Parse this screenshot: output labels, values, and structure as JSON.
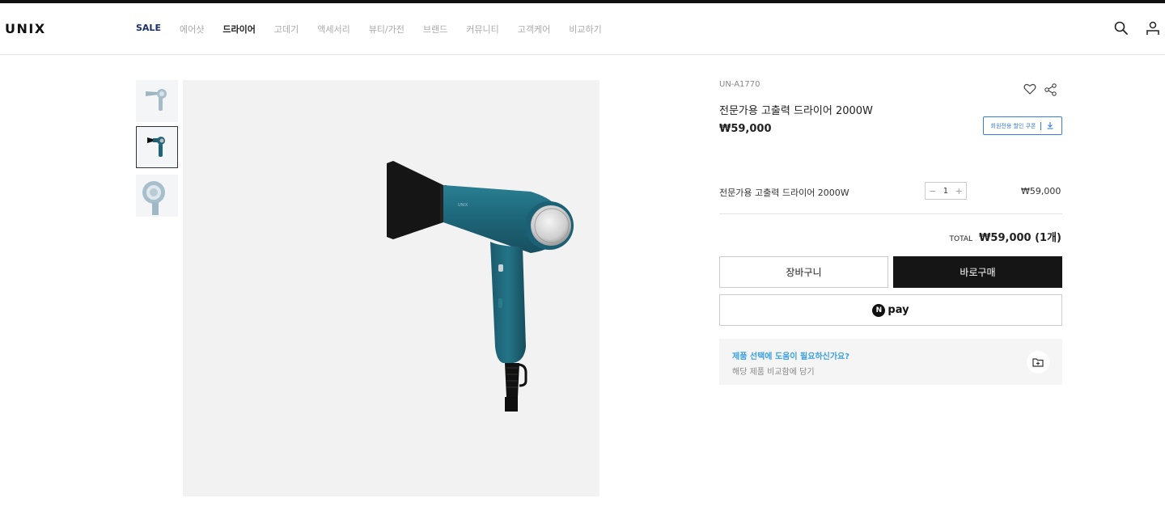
{
  "header": {
    "logo": "UNIX",
    "nav": [
      {
        "label": "SALE",
        "state": "sale"
      },
      {
        "label": "에어샷",
        "state": ""
      },
      {
        "label": "드라이어",
        "state": "active"
      },
      {
        "label": "고데기",
        "state": ""
      },
      {
        "label": "액세서리",
        "state": ""
      },
      {
        "label": "뷰티/가전",
        "state": ""
      },
      {
        "label": "브랜드",
        "state": ""
      },
      {
        "label": "커뮤니티",
        "state": ""
      },
      {
        "label": "고객케어",
        "state": ""
      },
      {
        "label": "비교하기",
        "state": ""
      }
    ],
    "icons": [
      "search-icon",
      "account-icon"
    ]
  },
  "gallery": {
    "thumbnails": [
      "dryer-front-light-blue",
      "dryer-side-teal",
      "dryer-detail-light-blue"
    ],
    "selected_index": 1
  },
  "product": {
    "model": "UN-A1770",
    "title": "전문가용 고출력 드라이어 2000W",
    "price": "₩59,000",
    "coupon_label": "회원전용 할인 쿠폰",
    "accent_color": "#3a7bd5"
  },
  "option": {
    "name": "전문가용 고출력 드라이어 2000W",
    "quantity": "1",
    "minus": "−",
    "plus": "+",
    "price": "₩59,000"
  },
  "total": {
    "label": "TOTAL",
    "value": "₩59,000 (1개)"
  },
  "buttons": {
    "cart": "장바구니",
    "buy": "바로구매",
    "npay_badge": "N",
    "npay": "pay"
  },
  "help": {
    "question": "제품 선택에 도움이 필요하신가요?",
    "sub": "해당 제품 비교함에 담기"
  }
}
